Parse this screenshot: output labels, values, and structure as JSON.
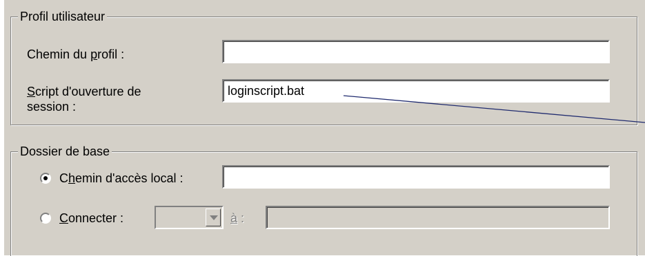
{
  "profil_group": {
    "title": "Profil utilisateur",
    "profile_path": {
      "label_pre": "Chemin du ",
      "label_key": "p",
      "label_post": "rofil :",
      "value": ""
    },
    "logon_script": {
      "label_key": "S",
      "label_line1": "cript d'ouverture de",
      "label_line2": "session :",
      "value": "loginscript.bat"
    }
  },
  "home_group": {
    "title": "Dossier de base",
    "local_path": {
      "selected": true,
      "label_pre": "C",
      "label_key": "h",
      "label_post": "emin d'accès local :",
      "value": ""
    },
    "connect": {
      "selected": false,
      "label_key": "C",
      "label_post": "onnecter :",
      "drive": "",
      "to_key": "à",
      "to_post": " :",
      "path": ""
    }
  },
  "colors": {
    "face": "#d4d0c8",
    "callout_line": "#1f2a6e"
  }
}
